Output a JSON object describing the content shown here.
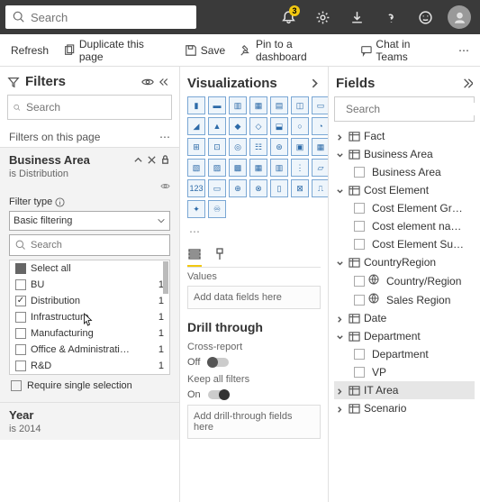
{
  "topbar": {
    "search_placeholder": "Search",
    "notification_count": "3"
  },
  "toolbar": {
    "refresh": "Refresh",
    "duplicate": "Duplicate this page",
    "save": "Save",
    "pin": "Pin to a dashboard",
    "chat": "Chat in Teams"
  },
  "filters": {
    "title": "Filters",
    "search_placeholder": "Search",
    "page_label": "Filters on this page",
    "card": {
      "name": "Business Area",
      "sub": "is Distribution",
      "filter_type_label": "Filter type",
      "filter_type_value": "Basic filtering",
      "inner_search_placeholder": "Search",
      "options": [
        {
          "label": "Select all",
          "count": "",
          "state": "filled"
        },
        {
          "label": "BU",
          "count": "1",
          "state": ""
        },
        {
          "label": "Distribution",
          "count": "1",
          "state": "checked"
        },
        {
          "label": "Infrastructure",
          "count": "1",
          "state": ""
        },
        {
          "label": "Manufacturing",
          "count": "1",
          "state": ""
        },
        {
          "label": "Office & Administrati…",
          "count": "1",
          "state": ""
        },
        {
          "label": "R&D",
          "count": "1",
          "state": ""
        }
      ],
      "require_single": "Require single selection"
    },
    "year_card": {
      "name": "Year",
      "sub": "is 2014"
    }
  },
  "viz": {
    "title": "Visualizations",
    "values_label": "Values",
    "values_drop": "Add data fields here",
    "drill_title": "Drill through",
    "cross_label": "Cross-report",
    "off_label": "Off",
    "keep_label": "Keep all filters",
    "on_label": "On",
    "drill_drop": "Add drill-through fields here"
  },
  "fields": {
    "title": "Fields",
    "search_placeholder": "Search",
    "tables": [
      {
        "name": "Fact",
        "expanded": false,
        "children": []
      },
      {
        "name": "Business Area",
        "expanded": true,
        "children": [
          {
            "name": "Business Area",
            "kind": "field"
          }
        ]
      },
      {
        "name": "Cost Element",
        "expanded": true,
        "children": [
          {
            "name": "Cost Element Gr…",
            "kind": "field"
          },
          {
            "name": "Cost element na…",
            "kind": "field"
          },
          {
            "name": "Cost Element Su…",
            "kind": "field"
          }
        ]
      },
      {
        "name": "CountryRegion",
        "expanded": true,
        "children": [
          {
            "name": "Country/Region",
            "kind": "geo"
          },
          {
            "name": "Sales Region",
            "kind": "geo"
          }
        ]
      },
      {
        "name": "Date",
        "expanded": false,
        "children": []
      },
      {
        "name": "Department",
        "expanded": true,
        "children": [
          {
            "name": "Department",
            "kind": "field"
          },
          {
            "name": "VP",
            "kind": "field"
          }
        ]
      },
      {
        "name": "IT Area",
        "expanded": false,
        "children": [],
        "selected": true
      },
      {
        "name": "Scenario",
        "expanded": false,
        "children": []
      }
    ]
  }
}
